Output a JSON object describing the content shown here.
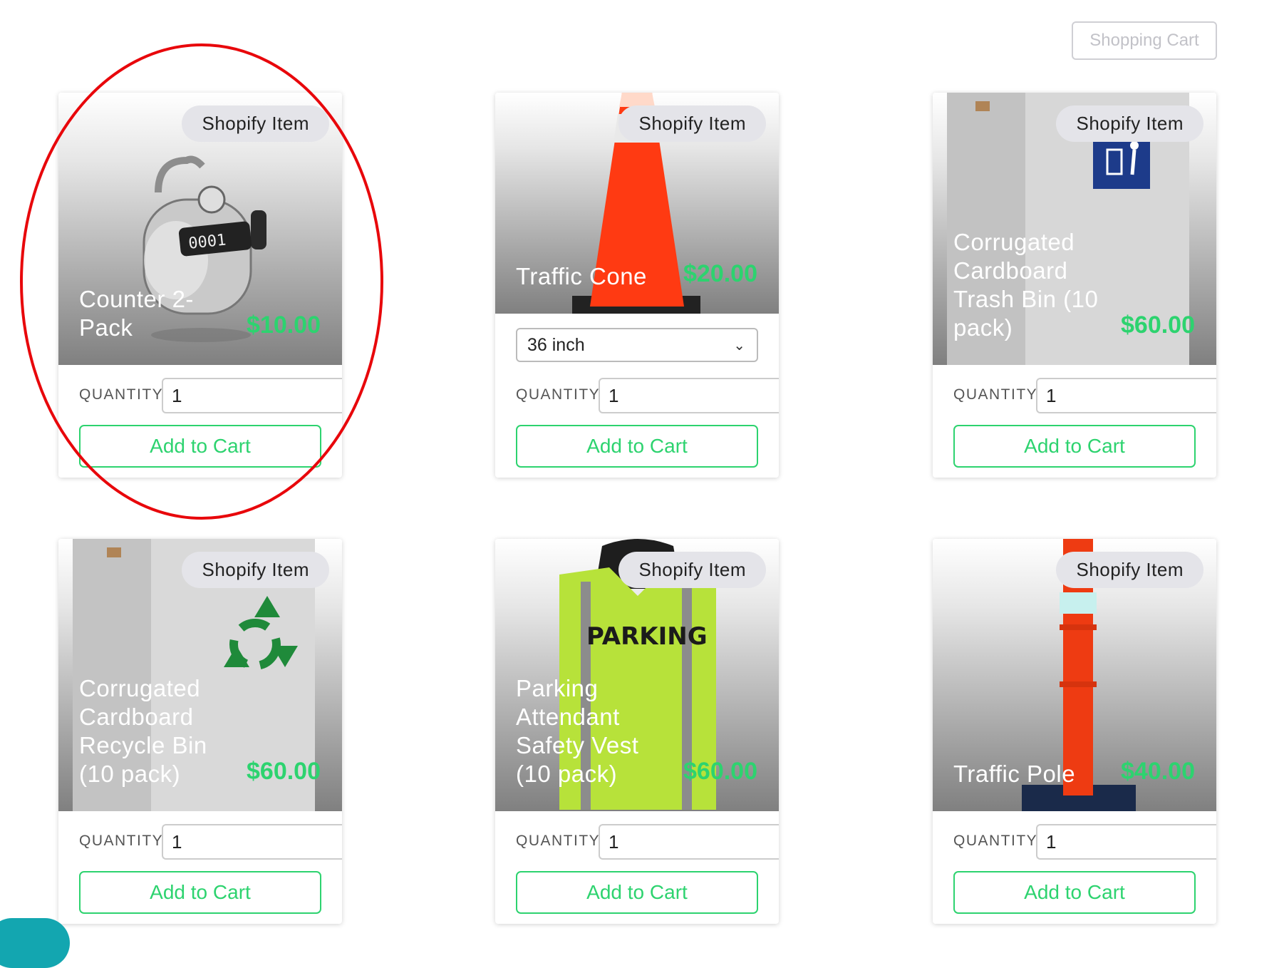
{
  "header": {
    "cart_label": "Shopping Cart"
  },
  "colors": {
    "accent_green": "#2dd36f",
    "annotation_red": "#e8070b"
  },
  "products": [
    {
      "badge": "Shopify Item",
      "title": "Counter 2-Pack",
      "price": "$10.00",
      "quantity_label": "QUANTITY",
      "quantity": "1",
      "add_label": "Add to Cart",
      "icon": "tally-counter-image"
    },
    {
      "badge": "Shopify Item",
      "title": "Traffic Cone",
      "price": "$20.00",
      "variant": "36 inch",
      "quantity_label": "QUANTITY",
      "quantity": "1",
      "add_label": "Add to Cart",
      "icon": "traffic-cone-image"
    },
    {
      "badge": "Shopify Item",
      "title": "Corrugated Cardboard Trash Bin (10 pack)",
      "price": "$60.00",
      "quantity_label": "QUANTITY",
      "quantity": "1",
      "add_label": "Add to Cart",
      "icon": "trash-bin-image"
    },
    {
      "badge": "Shopify Item",
      "title": "Corrugated Cardboard Recycle Bin (10 pack)",
      "price": "$60.00",
      "quantity_label": "QUANTITY",
      "quantity": "1",
      "add_label": "Add to Cart",
      "icon": "recycle-bin-image"
    },
    {
      "badge": "Shopify Item",
      "title": "Parking Attendant Safety Vest (10 pack)",
      "price": "$60.00",
      "vest_text": "PARKING",
      "quantity_label": "QUANTITY",
      "quantity": "1",
      "add_label": "Add to Cart",
      "icon": "safety-vest-image"
    },
    {
      "badge": "Shopify Item",
      "title": "Traffic Pole",
      "price": "$40.00",
      "quantity_label": "QUANTITY",
      "quantity": "1",
      "add_label": "Add to Cart",
      "icon": "traffic-pole-image"
    }
  ]
}
